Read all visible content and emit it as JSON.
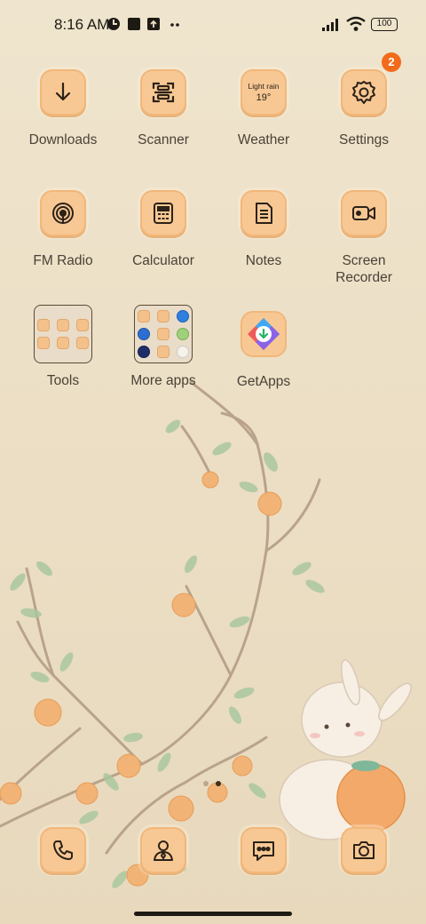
{
  "status": {
    "time": "8:16 AM",
    "battery": "100",
    "icons": [
      "data-saver-icon",
      "notification-square-icon",
      "upload-icon",
      "more-dots-icon",
      "signal-icon",
      "wifi-icon",
      "battery-icon"
    ]
  },
  "apps": [
    {
      "label": "Downloads",
      "icon": "download-arrow-icon"
    },
    {
      "label": "Scanner",
      "icon": "scanner-icon"
    },
    {
      "label": "Weather",
      "icon": "weather-widget-icon",
      "widget_line1": "Light rain",
      "widget_line2": "19°"
    },
    {
      "label": "Settings",
      "icon": "gear-icon",
      "badge": "2"
    },
    {
      "label": "FM Radio",
      "icon": "radio-icon"
    },
    {
      "label": "Calculator",
      "icon": "calculator-icon"
    },
    {
      "label": "Notes",
      "icon": "notes-icon"
    },
    {
      "label": "Screen\nRecorder",
      "icon": "video-camera-icon"
    },
    {
      "label": "Tools",
      "icon": "folder-icon"
    },
    {
      "label": "More apps",
      "icon": "folder-icon"
    },
    {
      "label": "GetApps",
      "icon": "getapps-icon"
    }
  ],
  "dock": [
    {
      "name": "phone",
      "icon": "phone-icon"
    },
    {
      "name": "contacts",
      "icon": "contacts-icon"
    },
    {
      "name": "messages",
      "icon": "messages-icon"
    },
    {
      "name": "camera",
      "icon": "camera-icon"
    }
  ],
  "colors": {
    "tile": "#f8c894",
    "badge": "#f26a1b",
    "wallpaper": "#ece0c8"
  }
}
